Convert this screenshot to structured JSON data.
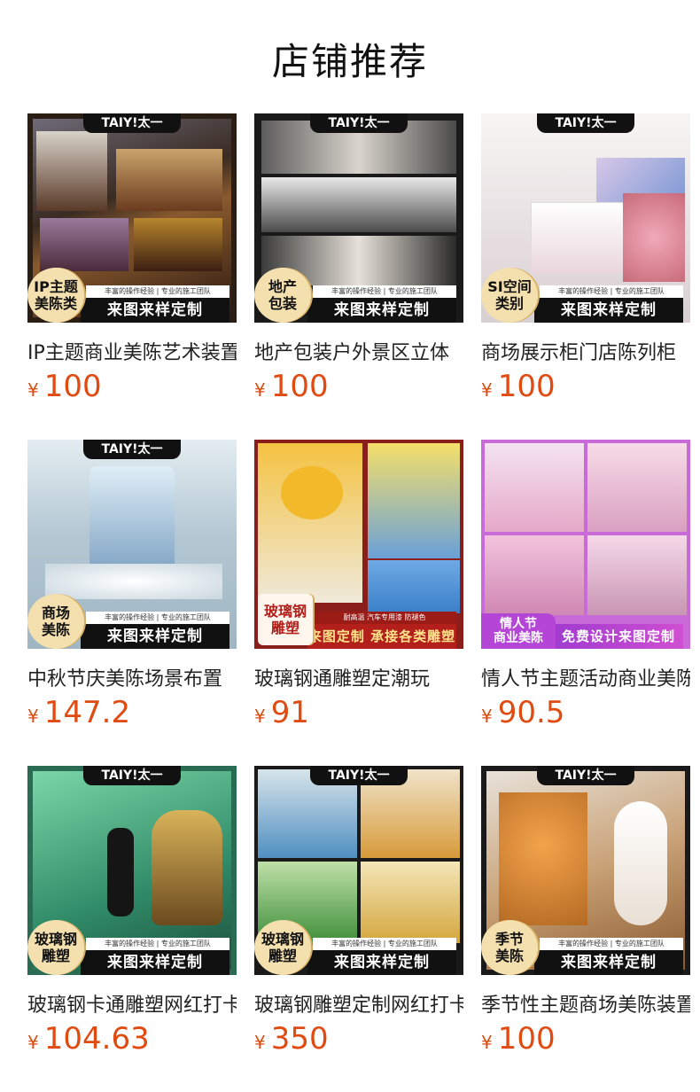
{
  "header": {
    "title": "店铺推荐"
  },
  "colors": {
    "price": "#e04b12",
    "badge_gold": "#f4dfae"
  },
  "products": [
    {
      "name": "IP主题商业美陈艺术装置",
      "currency": "¥",
      "price": "100",
      "badge_top": "TAIY!太一",
      "corner_label": "IP主题\n美陈类",
      "banner_sub": "丰富的操作经验 | 专业的施工团队",
      "banner_main": "来图来样定制"
    },
    {
      "name": "地产包装户外景区立体",
      "currency": "¥",
      "price": "100",
      "badge_top": "TAIY!太一",
      "corner_label": "地产\n包装",
      "banner_sub": "丰富的操作经验 | 专业的施工团队",
      "banner_main": "来图来样定制"
    },
    {
      "name": "商场展示柜门店陈列柜",
      "currency": "¥",
      "price": "100",
      "badge_top": "TAIY!太一",
      "corner_label": "SI空间\n类别",
      "banner_sub": "丰富的操作经验 | 专业的施工团队",
      "banner_main": "来图来样定制"
    },
    {
      "name": "中秋节庆美陈场景布置",
      "currency": "¥",
      "price": "147.2",
      "badge_top": "TAIY!太一",
      "corner_label": "商场\n美陈",
      "banner_sub": "丰富的操作经验 | 专业的施工团队",
      "banner_main": "来图来样定制"
    },
    {
      "name": "玻璃钢通雕塑定潮玩",
      "currency": "¥",
      "price": "91",
      "badge_top": "",
      "corner_label": "玻璃钢\n雕塑",
      "banner_sub": "耐高温 汽车专用漆 防褪色",
      "banner_main": "来图定制 承接各类雕塑"
    },
    {
      "name": "情人节主题活动商业美陈",
      "currency": "¥",
      "price": "90.5",
      "badge_top": "",
      "corner_label": "情人节\n商业美陈",
      "banner_sub": "",
      "banner_main": "免费设计来图定制"
    },
    {
      "name": "玻璃钢卡通雕塑网红打卡",
      "currency": "¥",
      "price": "104.63",
      "badge_top": "TAIY!太一",
      "corner_label": "玻璃钢\n雕塑",
      "banner_sub": "丰富的操作经验 | 专业的施工团队",
      "banner_main": "来图来样定制"
    },
    {
      "name": "玻璃钢雕塑定制网红打卡",
      "currency": "¥",
      "price": "350",
      "badge_top": "TAIY!太一",
      "corner_label": "玻璃钢\n雕塑",
      "banner_sub": "丰富的操作经验 | 专业的施工团队",
      "banner_main": "来图来样定制"
    },
    {
      "name": "季节性主题商场美陈装置",
      "currency": "¥",
      "price": "100",
      "badge_top": "TAIY!太一",
      "corner_label": "季节\n美陈",
      "banner_sub": "丰富的操作经验 | 专业的施工团队",
      "banner_main": "来图来样定制"
    }
  ]
}
